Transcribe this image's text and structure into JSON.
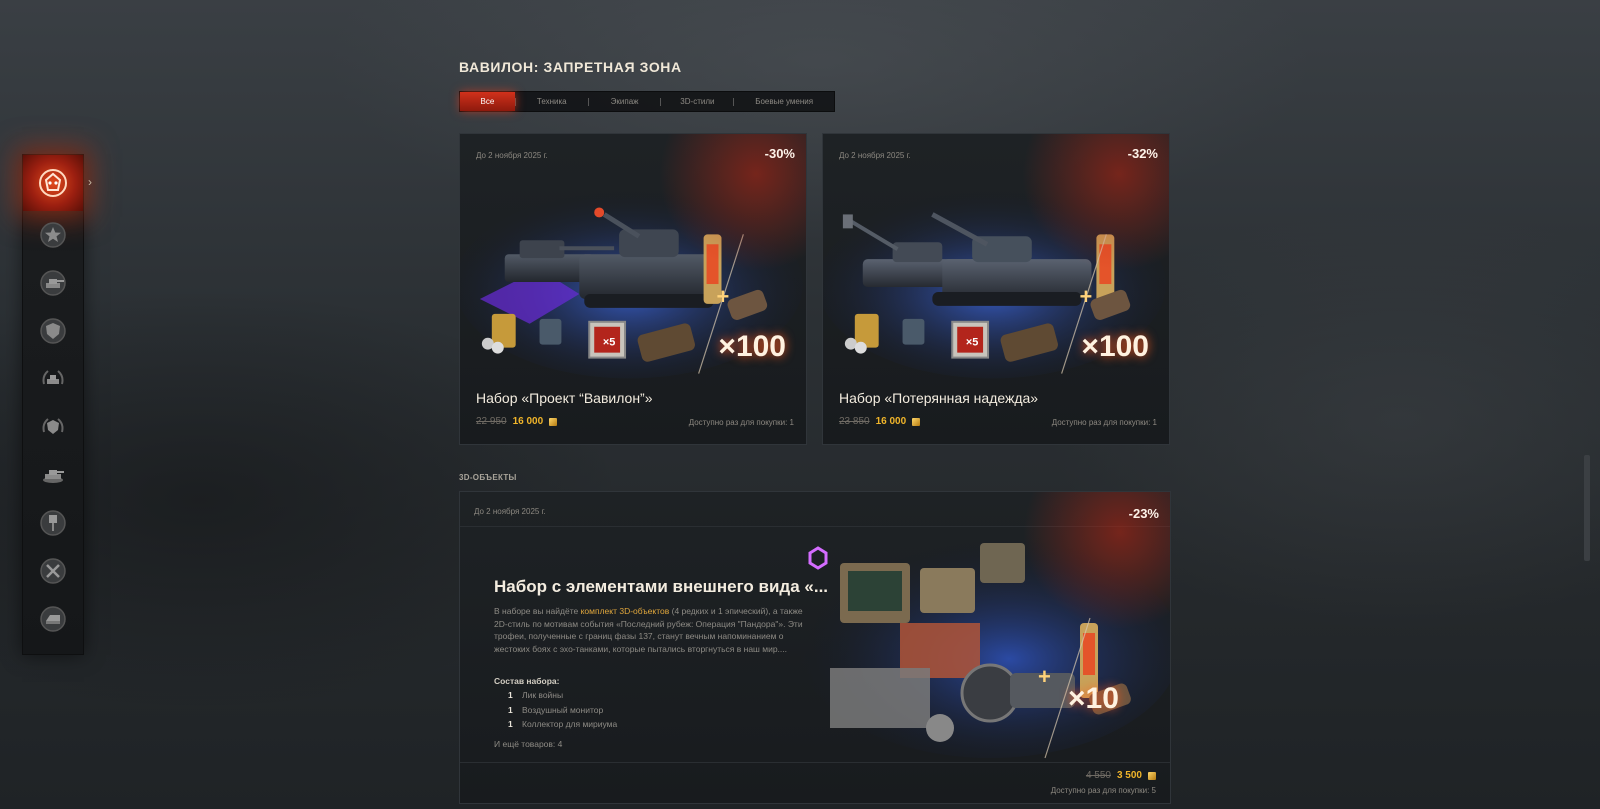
{
  "page": {
    "title": "ВАВИЛОН: ЗАПРЕТНАЯ ЗОНА"
  },
  "tabs": [
    {
      "label": "Все",
      "active": true
    },
    {
      "label": "Техника",
      "active": false
    },
    {
      "label": "Экипаж",
      "active": false
    },
    {
      "label": "3D-стили",
      "active": false
    },
    {
      "label": "Боевые умения",
      "active": false
    }
  ],
  "sidebar": {
    "items": [
      {
        "icon": "babylon-event-icon",
        "active": true
      },
      {
        "icon": "star-icon"
      },
      {
        "icon": "tank-turret-icon"
      },
      {
        "icon": "shield-badge-icon"
      },
      {
        "icon": "tank-laurel-icon"
      },
      {
        "icon": "world-of-tanks-emblem-icon"
      },
      {
        "icon": "tank-icon"
      },
      {
        "icon": "paint-brush-icon"
      },
      {
        "icon": "tools-icon"
      },
      {
        "icon": "gold-ingot-icon"
      }
    ]
  },
  "offers": [
    {
      "date": "До 2 ноября 2025 г.",
      "discount": "-30%",
      "name": "Набор «Проект “Вавилон”»",
      "old_price": "22 950",
      "new_price": "16 000",
      "limit": "Доступно раз для покупки: 1",
      "multiplier": "×100",
      "stamp": "×5"
    },
    {
      "date": "До 2 ноября 2025 г.",
      "discount": "-32%",
      "name": "Набор «Потерянная надежда»",
      "old_price": "23 850",
      "new_price": "16 000",
      "limit": "Доступно раз для покупки: 1",
      "multiplier": "×100",
      "stamp": "×5"
    }
  ],
  "section": {
    "label": "3D-ОБЪЕКТЫ"
  },
  "big_offer": {
    "date": "До 2 ноября 2025 г.",
    "discount": "-23%",
    "title": "Набор с элементами внешнего вида «...",
    "desc_before": "В наборе вы найдёте ",
    "desc_highlight": "комплект 3D-объектов",
    "desc_after": " (4 редких и 1 эпический), а также 2D-стиль по мотивам события «Последний рубеж: Операция \"Пандора\"». Эти трофеи, полученные с границ фазы 137, станут вечным напоминанием о жестоких боях с эхо-танками, которые пытались вторгнуться в наш мир....",
    "contents_title": "Состав набора:",
    "items": [
      {
        "qty": "1",
        "name": "Лик войны"
      },
      {
        "qty": "1",
        "name": "Воздушный монитор"
      },
      {
        "qty": "1",
        "name": "Коллектор для мириума"
      }
    ],
    "more": "И ещё товаров: 4",
    "old_price": "4 550",
    "new_price": "3 500",
    "limit": "Доступно раз для покупки: 5",
    "multiplier": "×10"
  },
  "colors": {
    "accent_red": "#d1311b",
    "gold": "#f0b52a",
    "highlight": "#e0a63c"
  }
}
